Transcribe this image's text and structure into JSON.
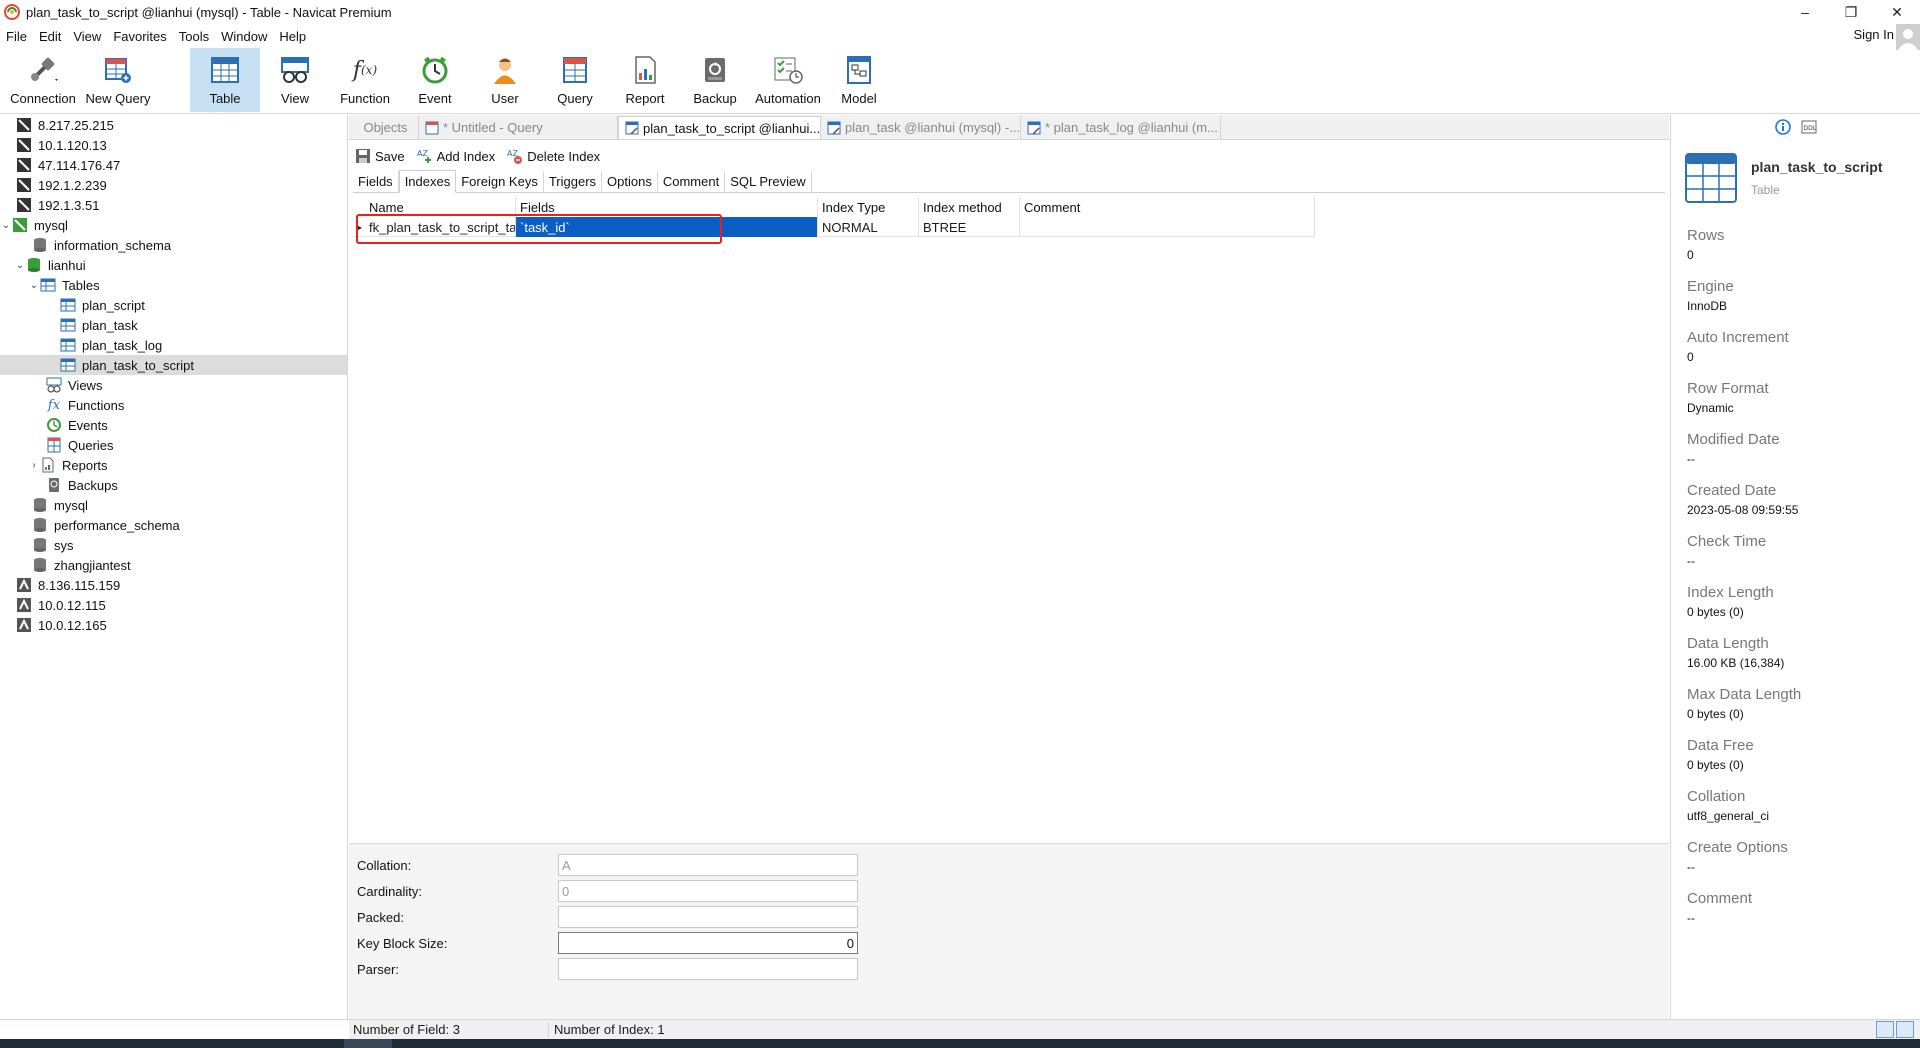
{
  "window": {
    "title": "plan_task_to_script @lianhui (mysql) - Table - Navicat Premium",
    "minimize": "–",
    "maximize": "❐",
    "close": "✕"
  },
  "menu": {
    "items": [
      "File",
      "Edit",
      "View",
      "Favorites",
      "Tools",
      "Window",
      "Help"
    ],
    "sign_in": "Sign In"
  },
  "toolbar": {
    "connection": "Connection",
    "new_query": "New Query",
    "table": "Table",
    "view": "View",
    "function": "Function",
    "event": "Event",
    "user": "User",
    "query": "Query",
    "report": "Report",
    "backup": "Backup",
    "automation": "Automation",
    "model": "Model"
  },
  "sidebar": {
    "items": [
      {
        "label": "8.217.25.215"
      },
      {
        "label": "10.1.120.13"
      },
      {
        "label": "47.114.176.47"
      },
      {
        "label": "192.1.2.239"
      },
      {
        "label": "192.1.3.51"
      },
      {
        "label": "mysql"
      },
      {
        "label": "information_schema"
      },
      {
        "label": "lianhui"
      },
      {
        "label": "Tables"
      },
      {
        "label": "plan_script"
      },
      {
        "label": "plan_task"
      },
      {
        "label": "plan_task_log"
      },
      {
        "label": "plan_task_to_script"
      },
      {
        "label": "Views"
      },
      {
        "label": "Functions"
      },
      {
        "label": "Events"
      },
      {
        "label": "Queries"
      },
      {
        "label": "Reports"
      },
      {
        "label": "Backups"
      },
      {
        "label": "mysql"
      },
      {
        "label": "performance_schema"
      },
      {
        "label": "sys"
      },
      {
        "label": "zhangjiantest"
      },
      {
        "label": "8.136.115.159"
      },
      {
        "label": "10.0.12.115"
      },
      {
        "label": "10.0.12.165"
      }
    ]
  },
  "tabs": {
    "objects": "Objects",
    "untitled_query": "* Untitled - Query",
    "plan_task_to_script": "plan_task_to_script @lianhui...",
    "plan_task": "plan_task @lianhui (mysql) -...",
    "plan_task_log": "* plan_task_log @lianhui (m..."
  },
  "actions": {
    "save": "Save",
    "add_index": "Add Index",
    "delete_index": "Delete Index"
  },
  "subtabs": [
    "Fields",
    "Indexes",
    "Foreign Keys",
    "Triggers",
    "Options",
    "Comment",
    "SQL Preview"
  ],
  "grid": {
    "columns": [
      "Name",
      "Fields",
      "Index Type",
      "Index method",
      "Comment"
    ],
    "row": {
      "name": "fk_plan_task_to_script_task",
      "fields": "`task_id`",
      "index_type": "NORMAL",
      "index_method": "BTREE",
      "comment": ""
    }
  },
  "props": {
    "collation_label": "Collation:",
    "collation_value": "A",
    "cardinality_label": "Cardinality:",
    "cardinality_value": "0",
    "packed_label": "Packed:",
    "packed_value": "",
    "key_block_label": "Key Block Size:",
    "key_block_value": "0",
    "parser_label": "Parser:",
    "parser_value": ""
  },
  "info": {
    "name": "plan_task_to_script",
    "type": "Table",
    "fields": [
      {
        "k": "Rows",
        "v": "0"
      },
      {
        "k": "Engine",
        "v": "InnoDB"
      },
      {
        "k": "Auto Increment",
        "v": "0"
      },
      {
        "k": "Row Format",
        "v": "Dynamic"
      },
      {
        "k": "Modified Date",
        "v": "--"
      },
      {
        "k": "Created Date",
        "v": "2023-05-08 09:59:55"
      },
      {
        "k": "Check Time",
        "v": "--"
      },
      {
        "k": "Index Length",
        "v": "0 bytes (0)"
      },
      {
        "k": "Data Length",
        "v": "16.00 KB (16,384)"
      },
      {
        "k": "Max Data Length",
        "v": "0 bytes (0)"
      },
      {
        "k": "Data Free",
        "v": "0 bytes (0)"
      },
      {
        "k": "Collation",
        "v": "utf8_general_ci"
      },
      {
        "k": "Create Options",
        "v": "--"
      },
      {
        "k": "Comment",
        "v": "--"
      }
    ]
  },
  "status": {
    "fields": "Number of Field: 3",
    "indexes": "Number of Index: 1"
  },
  "colors": {
    "accent": "#0a5ec4",
    "highlight_box": "#e8201e",
    "active_toolbar": "#c8e0f4"
  }
}
